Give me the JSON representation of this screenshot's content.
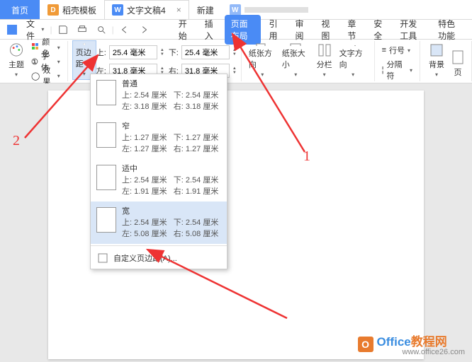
{
  "title_tabs": {
    "home": "首页",
    "template": "稻壳模板",
    "doc": "文字文稿4",
    "newtab": "新建"
  },
  "qat": {
    "file": "文件",
    "caret": "▾"
  },
  "menu": {
    "start": "开始",
    "insert": "插入",
    "layout": "页面布局",
    "refer": "引用",
    "review": "审阅",
    "view": "视图",
    "chapter": "章节",
    "security": "安全",
    "dev": "开发工具",
    "extra": "特色功能"
  },
  "ribbon": {
    "theme": "主题",
    "color": "颜色",
    "font": "字体",
    "effect": "效果",
    "margins": "页边距",
    "top_lbl": "上:",
    "bottom_lbl": "下:",
    "left_lbl": "左:",
    "right_lbl": "右:",
    "val_tb": "25.4 毫米",
    "val_lr": "31.8 毫米",
    "orient": "纸张方向",
    "size": "纸张大小",
    "columns": "分栏",
    "textdir": "文字方向",
    "lineno": "行号",
    "breaks": "分隔符",
    "bg": "背景",
    "pg": "页"
  },
  "dropdown": {
    "items": [
      {
        "name": "普通",
        "t": "上: 2.54 厘米",
        "b": "下: 2.54 厘米",
        "l": "左: 3.18 厘米",
        "r": "右: 3.18 厘米"
      },
      {
        "name": "窄",
        "t": "上: 1.27 厘米",
        "b": "下: 1.27 厘米",
        "l": "左: 1.27 厘米",
        "r": "右: 1.27 厘米"
      },
      {
        "name": "适中",
        "t": "上: 2.54 厘米",
        "b": "下: 2.54 厘米",
        "l": "左: 1.91 厘米",
        "r": "右: 1.91 厘米"
      },
      {
        "name": "宽",
        "t": "上: 2.54 厘米",
        "b": "下: 2.54 厘米",
        "l": "左: 5.08 厘米",
        "r": "右: 5.08 厘米"
      }
    ],
    "custom": "自定义页边距(A)..."
  },
  "annotations": {
    "one": "1",
    "two": "2"
  },
  "watermark": {
    "brand1": "Office",
    "brand2": "教程网",
    "url": "www.office26.com"
  }
}
